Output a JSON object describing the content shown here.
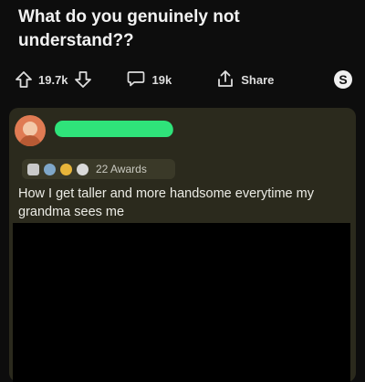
{
  "post": {
    "title": "What do you genuinely not understand??"
  },
  "actions": {
    "upvote_icon": "arrow-up-icon",
    "vote_count": "19.7k",
    "downvote_icon": "arrow-down-icon",
    "comment_icon": "speech-bubble-icon",
    "comment_count": "19k",
    "share_icon": "share-icon",
    "share_label": "Share",
    "badge_icon": "s-badge-icon"
  },
  "comment": {
    "avatar_icon": "avatar-icon",
    "username_redacted": true,
    "redaction_color": "#2fe37a",
    "awards_label": "22 Awards",
    "text": "How I get taller and more handsome everytime my grandma sees me"
  },
  "colors": {
    "background": "#0d0d0d",
    "card": "#2b2a1d"
  }
}
